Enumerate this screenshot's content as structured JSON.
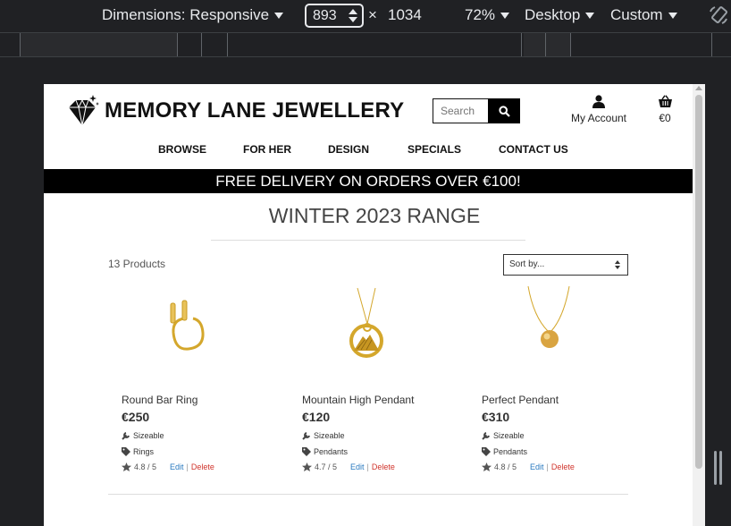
{
  "devtools": {
    "dimensions_label": "Dimensions: Responsive",
    "width_value": "893",
    "times": "×",
    "height_value": "1034",
    "zoom": "72%",
    "device_mode": "Desktop",
    "throttle": "Custom"
  },
  "site": {
    "logo_text": "MEMORY LANE JEWELLERY",
    "search_placeholder": "Search",
    "account_label": "My Account",
    "basket_total": "€0",
    "nav": [
      "BROWSE",
      "FOR HER",
      "DESIGN",
      "SPECIALS",
      "CONTACT US"
    ],
    "banner": "FREE DELIVERY ON ORDERS OVER €100!",
    "range_title": "WINTER 2023 RANGE",
    "product_count": "13 Products",
    "sort_label": "Sort by..."
  },
  "products": [
    {
      "name": "Round Bar Ring",
      "price": "€250",
      "feature": "Sizeable",
      "category": "Rings",
      "rating": "4.8 / 5",
      "edit": "Edit",
      "sep": "|",
      "delete": "Delete"
    },
    {
      "name": "Mountain High Pendant",
      "price": "€120",
      "feature": "Sizeable",
      "category": "Pendants",
      "rating": "4.7 / 5",
      "edit": "Edit",
      "sep": "|",
      "delete": "Delete"
    },
    {
      "name": "Perfect Pendant",
      "price": "€310",
      "feature": "Sizeable",
      "category": "Pendants",
      "rating": "4.8 / 5",
      "edit": "Edit",
      "sep": "|",
      "delete": "Delete"
    }
  ],
  "colors": {
    "banner_bg": "#000000",
    "edit_link": "#2a7ac0",
    "delete_link": "#d0342c",
    "gold": "#d4a72c"
  }
}
